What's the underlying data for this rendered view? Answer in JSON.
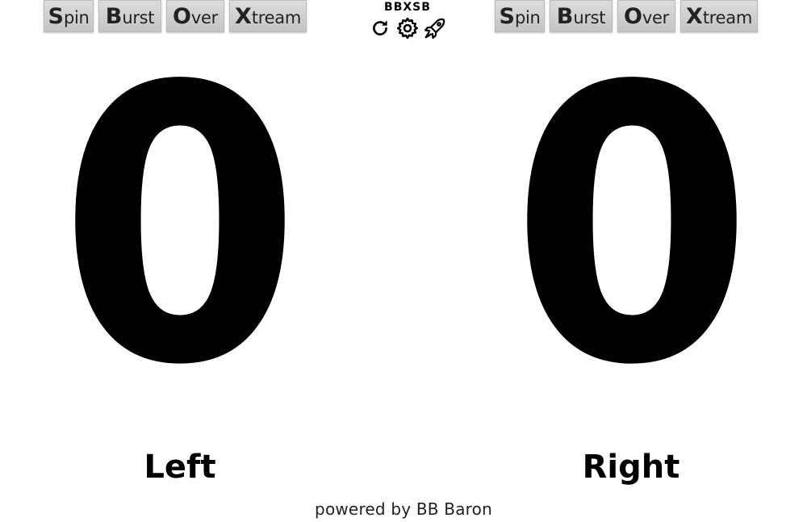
{
  "left_buttons": [
    {
      "initial": "S",
      "rest": "pin"
    },
    {
      "initial": "B",
      "rest": "urst"
    },
    {
      "initial": "O",
      "rest": "ver"
    },
    {
      "initial": "X",
      "rest": "tream"
    }
  ],
  "right_buttons": [
    {
      "initial": "S",
      "rest": "pin"
    },
    {
      "initial": "B",
      "rest": "urst"
    },
    {
      "initial": "O",
      "rest": "ver"
    },
    {
      "initial": "X",
      "rest": "tream"
    }
  ],
  "header": {
    "title": "BBXSB",
    "icons": [
      "refresh-icon",
      "gear-icon",
      "rocket-icon"
    ]
  },
  "scores": {
    "left": "0",
    "right": "0"
  },
  "labels": {
    "left": "Left",
    "right": "Right"
  },
  "footer": {
    "text": "powered by BB Baron"
  }
}
